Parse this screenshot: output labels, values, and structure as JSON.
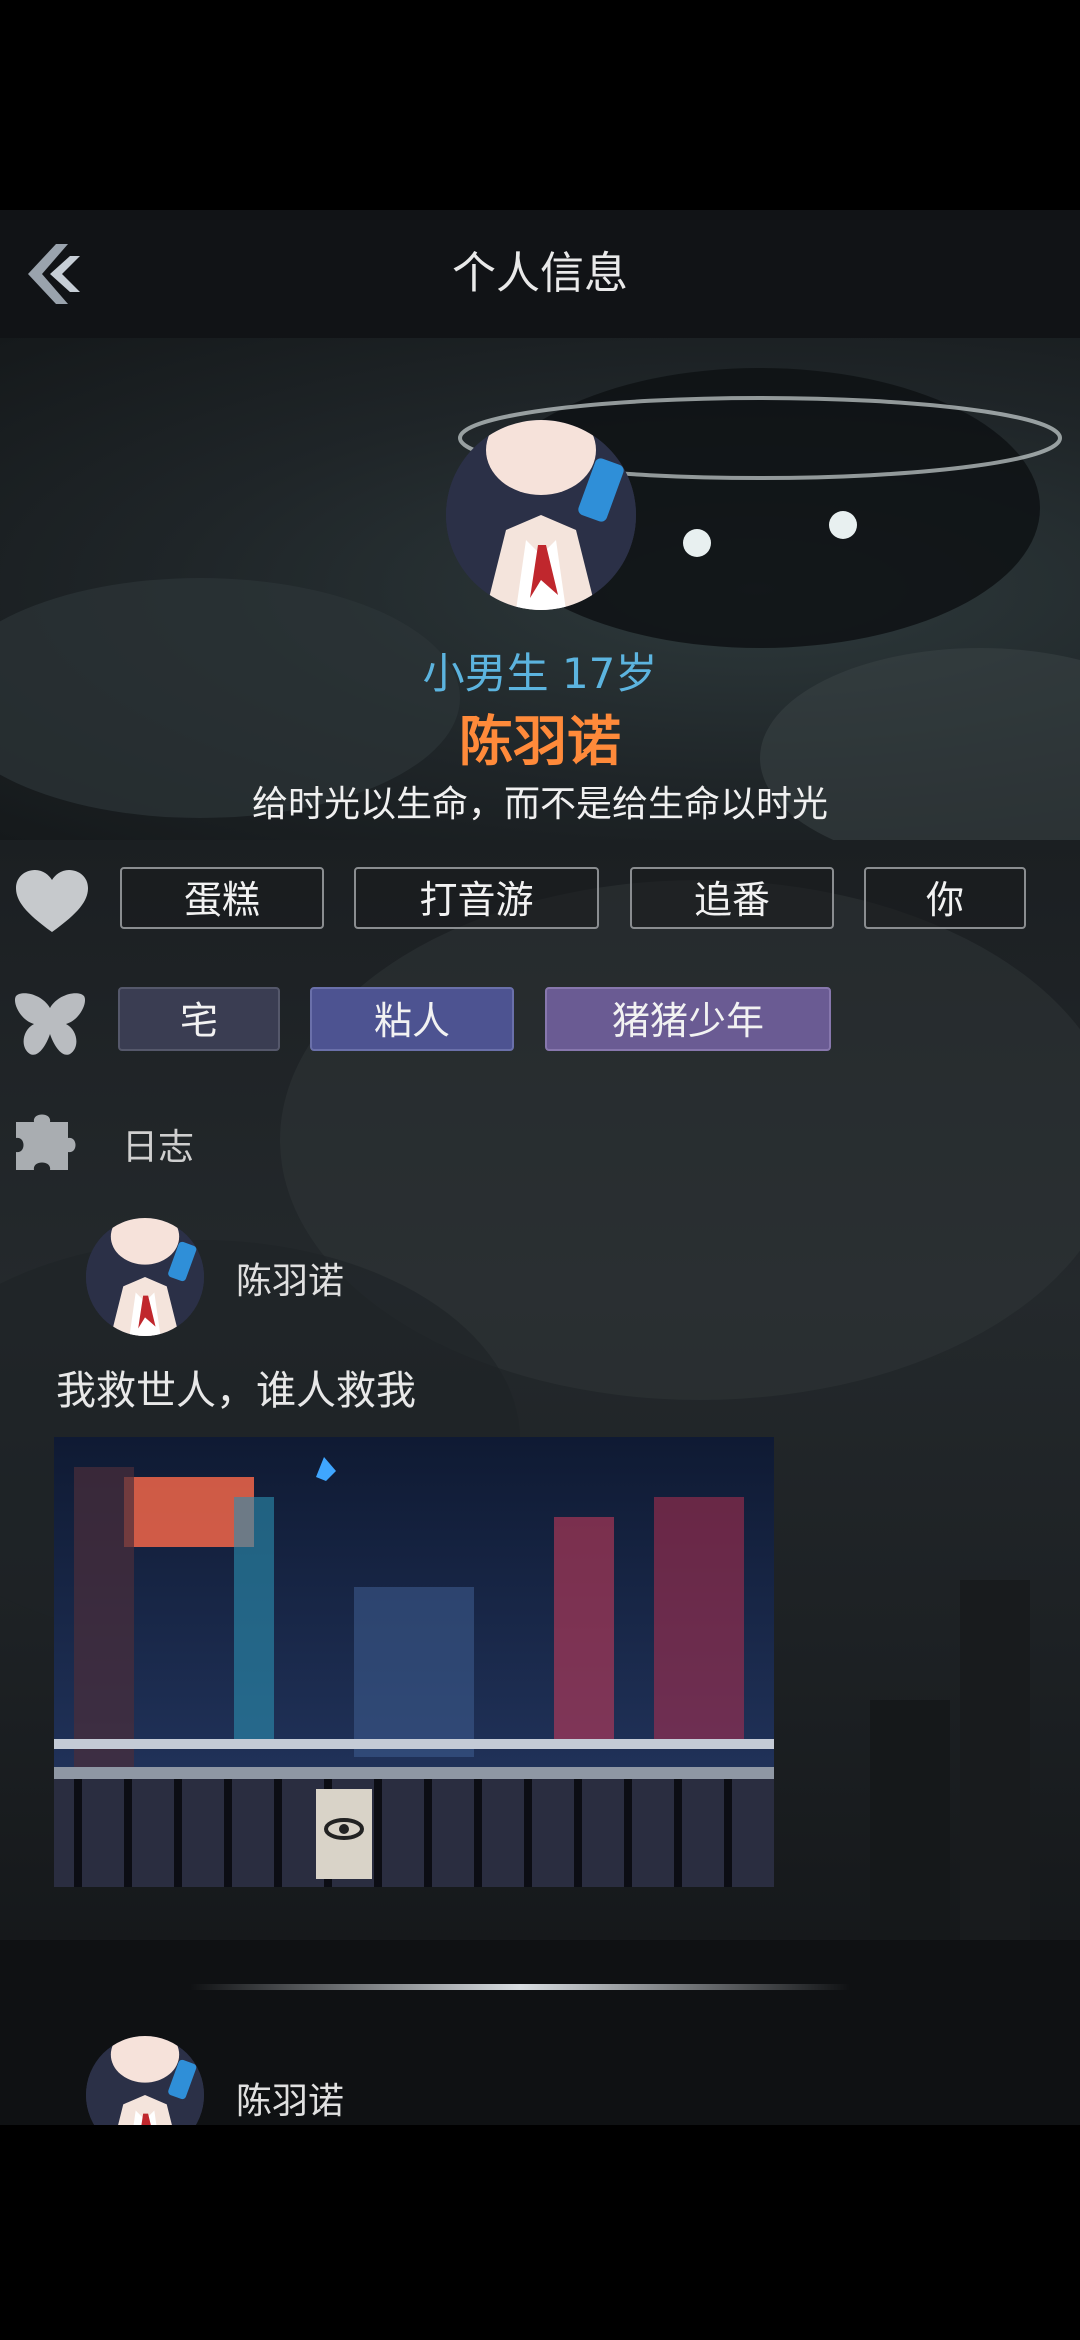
{
  "header": {
    "title": "个人信息"
  },
  "profile": {
    "age_text": "小男生 17岁",
    "name": "陈羽诺",
    "motto": "给时光以生命，而不是给生命以时光"
  },
  "likes": [
    "蛋糕",
    "打音游",
    "追番",
    "你"
  ],
  "traits": [
    {
      "label": "宅",
      "color": "#3a3d52"
    },
    {
      "label": "粘人",
      "color": "#4d5391"
    },
    {
      "label": "猪猪少年",
      "color": "#6a5b93"
    }
  ],
  "log": {
    "label": "日志"
  },
  "posts": [
    {
      "author": "陈羽诺",
      "text": "我救世人，谁人救我"
    },
    {
      "author": "陈羽诺"
    }
  ],
  "icons": {
    "back": "back-arrow-icon",
    "likes": "heart-icon",
    "traits": "butterfly-icon",
    "log": "puzzle-icon"
  }
}
